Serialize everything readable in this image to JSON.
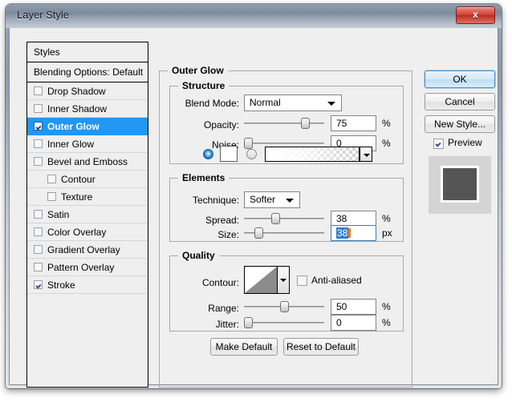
{
  "window": {
    "title": "Layer Style",
    "close_label": "x"
  },
  "styles_panel": {
    "header": "Styles",
    "blending_options": "Blending Options: Default",
    "effects": [
      {
        "label": "Drop Shadow",
        "checked": false,
        "indent": false,
        "selected": false
      },
      {
        "label": "Inner Shadow",
        "checked": false,
        "indent": false,
        "selected": false
      },
      {
        "label": "Outer Glow",
        "checked": true,
        "indent": false,
        "selected": true
      },
      {
        "label": "Inner Glow",
        "checked": false,
        "indent": false,
        "selected": false
      },
      {
        "label": "Bevel and Emboss",
        "checked": false,
        "indent": false,
        "selected": false
      },
      {
        "label": "Contour",
        "checked": false,
        "indent": true,
        "selected": false
      },
      {
        "label": "Texture",
        "checked": false,
        "indent": true,
        "selected": false
      },
      {
        "label": "Satin",
        "checked": false,
        "indent": false,
        "selected": false
      },
      {
        "label": "Color Overlay",
        "checked": false,
        "indent": false,
        "selected": false
      },
      {
        "label": "Gradient Overlay",
        "checked": false,
        "indent": false,
        "selected": false
      },
      {
        "label": "Pattern Overlay",
        "checked": false,
        "indent": false,
        "selected": false
      },
      {
        "label": "Stroke",
        "checked": true,
        "indent": false,
        "selected": false
      }
    ]
  },
  "panel": {
    "title": "Outer Glow",
    "structure": {
      "title": "Structure",
      "blend_mode_label": "Blend Mode:",
      "blend_mode_value": "Normal",
      "opacity_label": "Opacity:",
      "opacity_value": "75",
      "opacity_unit": "%",
      "noise_label": "Noise:",
      "noise_value": "0",
      "noise_unit": "%",
      "color_radio_selected": true,
      "color_swatch": "#ffffff",
      "gradient_radio_selected": false
    },
    "elements": {
      "title": "Elements",
      "technique_label": "Technique:",
      "technique_value": "Softer",
      "spread_label": "Spread:",
      "spread_value": "38",
      "spread_unit": "%",
      "size_label": "Size:",
      "size_value": "38",
      "size_unit": "px",
      "size_field_focused": true
    },
    "quality": {
      "title": "Quality",
      "contour_label": "Contour:",
      "anti_aliased_label": "Anti-aliased",
      "anti_aliased_checked": false,
      "range_label": "Range:",
      "range_value": "50",
      "range_unit": "%",
      "jitter_label": "Jitter:",
      "jitter_value": "0",
      "jitter_unit": "%"
    },
    "make_default_label": "Make Default",
    "reset_default_label": "Reset to Default"
  },
  "buttons": {
    "ok": "OK",
    "cancel": "Cancel",
    "new_style": "New Style...",
    "preview_label": "Preview",
    "preview_checked": true
  },
  "colors": {
    "selection_blue": "#2196f3",
    "title_bar": "#8d9aa9",
    "dialog_bg": "#efefef",
    "close_red": "#d2453a",
    "field_selection": "#2f7fd0",
    "caret_orange": "#e08020"
  }
}
